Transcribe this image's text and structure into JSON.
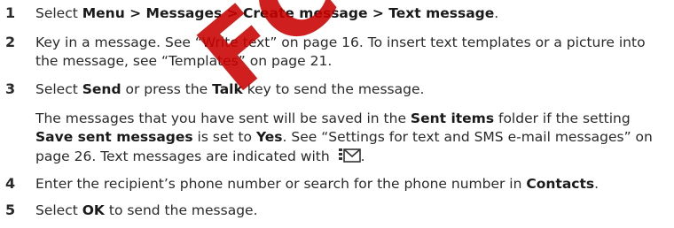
{
  "steps": [
    {
      "number": "1",
      "lines": [
        [
          "Select ",
          {
            "b": "Menu > Messages > Create message > Text message"
          },
          "."
        ]
      ]
    },
    {
      "number": "2",
      "lines": [
        [
          "Key in a message. See “Write text” on page 16. To insert text templates or a picture into"
        ],
        [
          "the message, see “Templates” on page 21."
        ]
      ]
    },
    {
      "number": "3",
      "lines": [
        [
          "Select ",
          {
            "b": "Send"
          },
          " or press the ",
          {
            "b": "Talk"
          },
          " key to send the message."
        ]
      ]
    },
    {
      "number": "",
      "lines": [
        [
          "The messages that you have sent will be saved in the ",
          {
            "b": "Sent items"
          },
          " folder if the setting"
        ],
        [
          {
            "b": "Save sent messages"
          },
          " is set to ",
          {
            "b": "Yes"
          },
          ". See “Settings for text and SMS e-mail messages” on"
        ],
        [
          "page 26. Text messages are indicated with ",
          {
            "icon": "message-envelope-icon"
          },
          "."
        ]
      ]
    },
    {
      "number": "4",
      "lines": [
        [
          "Enter the recipient’s phone number or search for the phone number in ",
          {
            "b": "Contacts"
          },
          "."
        ]
      ]
    },
    {
      "number": "5",
      "lines": [
        [
          "Select ",
          {
            "b": "OK"
          },
          " to send the message."
        ]
      ]
    }
  ],
  "watermark": {
    "text": "FCC",
    "color": "#c80000"
  }
}
